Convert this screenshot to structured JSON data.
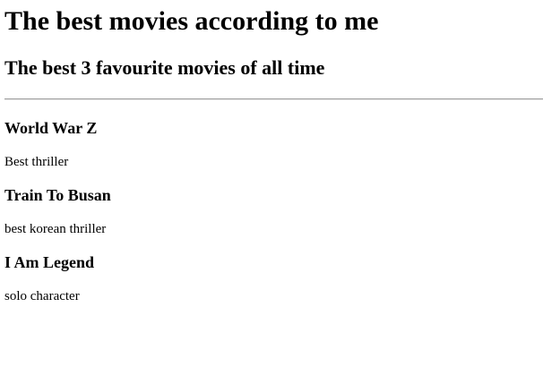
{
  "page": {
    "heading": "The best movies according to me",
    "subheading": "The best 3 favourite movies of all time"
  },
  "movies": [
    {
      "title": "World War Z",
      "description": "Best thriller"
    },
    {
      "title": "Train To Busan",
      "description": "best korean thriller"
    },
    {
      "title": "I Am Legend",
      "description": "solo character"
    }
  ]
}
